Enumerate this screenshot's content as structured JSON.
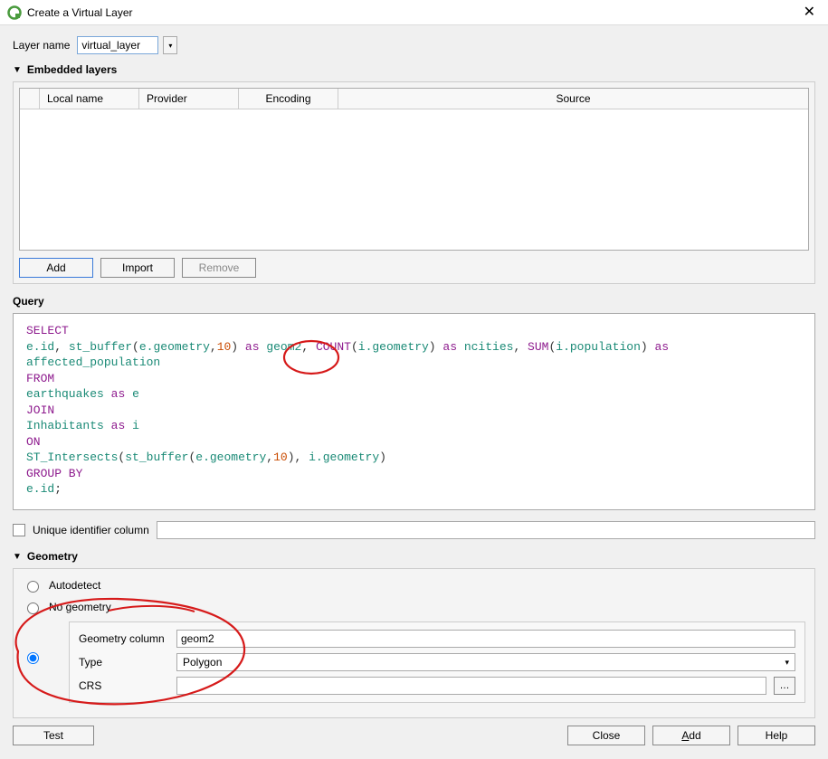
{
  "titlebar": {
    "title": "Create a Virtual Layer",
    "close_icon": "close-icon"
  },
  "layer_name": {
    "label": "Layer name",
    "value": "virtual_layer"
  },
  "embedded": {
    "header": "Embedded layers",
    "columns": {
      "local_name": "Local name",
      "provider": "Provider",
      "encoding": "Encoding",
      "source": "Source"
    },
    "buttons": {
      "add": "Add",
      "import": "Import",
      "remove": "Remove"
    }
  },
  "query": {
    "label": "Query",
    "tokens": [
      [
        {
          "t": "kw",
          "v": "SELECT"
        }
      ],
      [
        {
          "t": "ident",
          "v": "e.id"
        },
        {
          "t": "op",
          "v": ", "
        },
        {
          "t": "ident",
          "v": "st_buffer"
        },
        {
          "t": "op",
          "v": "("
        },
        {
          "t": "ident",
          "v": "e.geometry"
        },
        {
          "t": "op",
          "v": ","
        },
        {
          "t": "num",
          "v": "10"
        },
        {
          "t": "op",
          "v": ") "
        },
        {
          "t": "kw",
          "v": "as"
        },
        {
          "t": "op",
          "v": " "
        },
        {
          "t": "ident",
          "v": "geom2"
        },
        {
          "t": "op",
          "v": ", "
        },
        {
          "t": "kw",
          "v": "COUNT"
        },
        {
          "t": "op",
          "v": "("
        },
        {
          "t": "ident",
          "v": "i.geometry"
        },
        {
          "t": "op",
          "v": ") "
        },
        {
          "t": "kw",
          "v": "as"
        },
        {
          "t": "op",
          "v": " "
        },
        {
          "t": "ident",
          "v": "ncities"
        },
        {
          "t": "op",
          "v": ", "
        },
        {
          "t": "kw",
          "v": "SUM"
        },
        {
          "t": "op",
          "v": "("
        },
        {
          "t": "ident",
          "v": "i.population"
        },
        {
          "t": "op",
          "v": ") "
        },
        {
          "t": "kw",
          "v": "as"
        }
      ],
      [
        {
          "t": "ident",
          "v": "affected_population"
        }
      ],
      [
        {
          "t": "kw",
          "v": "FROM"
        }
      ],
      [
        {
          "t": "ident",
          "v": "earthquakes"
        },
        {
          "t": "op",
          "v": " "
        },
        {
          "t": "kw",
          "v": "as"
        },
        {
          "t": "op",
          "v": " "
        },
        {
          "t": "ident",
          "v": "e"
        }
      ],
      [
        {
          "t": "kw",
          "v": "JOIN"
        }
      ],
      [
        {
          "t": "ident",
          "v": "Inhabitants"
        },
        {
          "t": "op",
          "v": " "
        },
        {
          "t": "kw",
          "v": "as"
        },
        {
          "t": "op",
          "v": " "
        },
        {
          "t": "ident",
          "v": "i"
        }
      ],
      [
        {
          "t": "kw",
          "v": "ON"
        }
      ],
      [
        {
          "t": "ident",
          "v": "ST_Intersects"
        },
        {
          "t": "op",
          "v": "("
        },
        {
          "t": "ident",
          "v": "st_buffer"
        },
        {
          "t": "op",
          "v": "("
        },
        {
          "t": "ident",
          "v": "e.geometry"
        },
        {
          "t": "op",
          "v": ","
        },
        {
          "t": "num",
          "v": "10"
        },
        {
          "t": "op",
          "v": "), "
        },
        {
          "t": "ident",
          "v": "i.geometry"
        },
        {
          "t": "op",
          "v": ")"
        }
      ],
      [
        {
          "t": "kw",
          "v": "GROUP BY"
        }
      ],
      [
        {
          "t": "ident",
          "v": "e.id"
        },
        {
          "t": "op",
          "v": ";"
        }
      ]
    ]
  },
  "uid": {
    "label": "Unique identifier column",
    "value": ""
  },
  "geometry": {
    "header": "Geometry",
    "autodetect": "Autodetect",
    "no_geometry": "No geometry",
    "column_label": "Geometry column",
    "column_value": "geom2",
    "type_label": "Type",
    "type_value": "Polygon",
    "crs_label": "CRS",
    "crs_value": "",
    "browse": "…"
  },
  "footer": {
    "test": "Test",
    "close": "Close",
    "add": "Add",
    "help": "Help"
  }
}
